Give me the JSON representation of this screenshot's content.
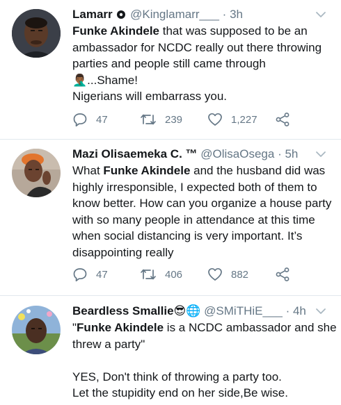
{
  "colors": {
    "text": "#14171a",
    "muted": "#657786",
    "divider": "#e1e8ed",
    "caret": "#aab8c2"
  },
  "tweets": [
    {
      "name": "Lamarr",
      "handle": "@Kinglamarr___",
      "time": "3h",
      "body_parts": {
        "mention": "Funke Akindele",
        "line1_rest": " that was supposed to be an",
        "line2": "ambassador for NCDC really out there throwing",
        "line3": "parties and people still came through",
        "line4_emoji": "🤦🏾‍♂️",
        "line4_rest": "...Shame!",
        "line5": "Nigerians will embarrass you."
      },
      "replies": "47",
      "retweets": "239",
      "likes": "1,227"
    },
    {
      "name": "Mazi Olisaemeka C. ™",
      "handle": "@OlisaOsega",
      "time": "5h",
      "body_parts": {
        "line1_pre": "What ",
        "mention": "Funke Akindele",
        "line1_rest": " and the husband did was",
        "line2": "highly irresponsible, I expected both of them to",
        "line3": "know better. How can you organize a house party",
        "line4": "with so many people in attendance at this time",
        "line5": "when social distancing is very important. It’s",
        "line6": "disappointing really"
      },
      "replies": "47",
      "retweets": "406",
      "likes": "882"
    },
    {
      "name": "Beardless Smallie",
      "name_emojis": "😎🌐",
      "handle": "@SMiTHiE___",
      "time": "4h",
      "body_parts": {
        "line1_pre": "\"",
        "mention": "Funke Akindele",
        "line1_rest": " is a NCDC ambassador and she",
        "line2": "threw a party\"",
        "line4": "YES, Don't think of throwing a party too.",
        "line5": "Let the stupidity end on her side,Be wise."
      }
    }
  ]
}
